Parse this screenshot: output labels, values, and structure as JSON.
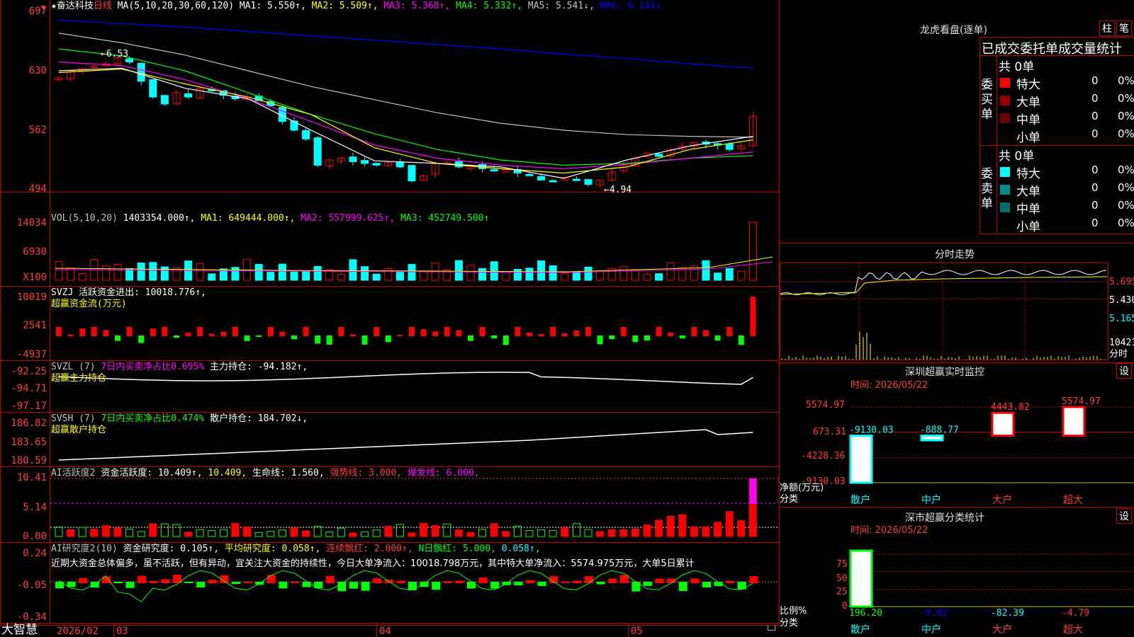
{
  "stock": {
    "star": "★",
    "name": "奋达科技",
    "period": "日线"
  },
  "main_legend": {
    "ma_label": "MA(5,10,20,30,60,120)",
    "ma1": "MA1: 5.550↑,",
    "ma2": "MA2: 5.509↑,",
    "ma3": "MA3: 5.368↑,",
    "ma4": "MA4: 5.332↑,",
    "ma5": "MA5: 5.541↓,",
    "ma6": "MA6: 6.141↓"
  },
  "price_axis": [
    "697",
    "630",
    "562",
    "494"
  ],
  "annotations": {
    "high": "←6.53",
    "low": "←4.94"
  },
  "vol_panel": {
    "label": "VOL(5,10,20)",
    "value": "1403354.000↑,",
    "ma1": "MA1: 649444.000↑,",
    "ma2": "MA2: 557999.625↑,",
    "ma3": "MA3: 452749.500↑",
    "axis": [
      "14034",
      "6930",
      "X100"
    ]
  },
  "svzj_panel": {
    "line1": "SVZJ  活跃资金进出: 10018.776↑,",
    "line2": "超赢资金流(万元)",
    "axis": [
      "10019",
      "2541",
      "-4937"
    ]
  },
  "svzl_panel": {
    "prefix": "SVZL (7)",
    "ratio": "7日内买卖净占比0.695%",
    "value": "主力持仓: -94.182↑,",
    "line2": "超赢主力持仓",
    "axis": [
      "-92.25",
      "-94.71",
      "-97.17"
    ]
  },
  "svsh_panel": {
    "prefix": "SVSH (7)",
    "ratio": "7日内买卖净占比0.474%",
    "value": "散户持仓: 184.702↓,",
    "line2": "超赢散户持仓",
    "axis": [
      "186.82",
      "183.65",
      "180.59"
    ]
  },
  "ai_active_panel": {
    "prefix": "AI活跃度2",
    "a": "资金活跃度: 10.409↑,",
    "b": "10.409,",
    "c": "生命线: 1.560,",
    "d": "强势线: 3.000,",
    "e": "爆发线: 6.000,",
    "axis": [
      "10.41",
      "5.14",
      "0.00"
    ]
  },
  "ai_research_panel": {
    "prefix": "AI研究度2(10)",
    "a": "资金研究度: 0.105↑,",
    "b": "平均研究度: 0.058↑,",
    "c": "连续飘红: 2.000↑,",
    "d": "N日飘红: 5.000,",
    "e": "0.058↑,",
    "comment": "近期大资金总体偏多，虽不活跃，但有异动，宜关注大资金的持续性，今日大单净流入：10018.798万元，其中特大单净流入：5574.975万元，大单5日累计",
    "axis": [
      "0.24",
      "-0.05",
      "-0.34"
    ]
  },
  "bottom_bar": {
    "brand": "大智慧",
    "date": "2026/02",
    "m3": "03",
    "m4": "04",
    "m5": "05"
  },
  "right_panel": {
    "title": "龙虎看盘(逐单)",
    "btn_zhu": "柱",
    "btn_bi": "笔",
    "header": "已成交委托单成交量统计",
    "buy_side": "委买单",
    "buy_count": "共 0单",
    "sell_side": "委卖单",
    "sell_count": "共 0单",
    "buy_rows": [
      {
        "label": "特大",
        "val": "0",
        "pct": "0%",
        "color": "#ff0000"
      },
      {
        "label": "大单",
        "val": "0",
        "pct": "0%",
        "color": "#9a0000"
      },
      {
        "label": "中单",
        "val": "0",
        "pct": "0%",
        "color": "#6b0000"
      },
      {
        "label": "小单",
        "val": "0",
        "pct": "0%",
        "color": ""
      }
    ],
    "sell_rows": [
      {
        "label": "特大",
        "val": "0",
        "pct": "0%",
        "color": "#00ffff"
      },
      {
        "label": "大单",
        "val": "0",
        "pct": "0%",
        "color": "#008b8b"
      },
      {
        "label": "中单",
        "val": "0",
        "pct": "0%",
        "color": "#006b6b"
      },
      {
        "label": "小单",
        "val": "0",
        "pct": "0%",
        "color": ""
      }
    ],
    "intraday": {
      "title": "分时走势",
      "axis": [
        "5.695",
        "5.430",
        "5.165",
        "10421",
        "分时"
      ]
    },
    "sz_monitor": {
      "title": "深圳超赢实时监控",
      "btn": "设",
      "date": "时间: 2026/05/22",
      "axis": [
        "5574.97",
        "673.31",
        "-4228.36",
        "-9130.03"
      ],
      "axis_note": "净额(万元)",
      "axis_note2": "分类"
    },
    "sz_stats": {
      "title": "深市超赢分类统计",
      "btn": "设",
      "date": "时间: 2026/05/22",
      "axis": [
        "75",
        "50",
        "25",
        "0"
      ],
      "axis_note": "比例%",
      "axis_note2": "分类"
    }
  },
  "chart_data": [
    {
      "type": "bar",
      "title": "深圳超赢实时监控",
      "ylabel": "净额(万元)",
      "categories": [
        "散户",
        "中户",
        "大户",
        "超大"
      ],
      "values": [
        -9130.03,
        -888.77,
        4443.82,
        5574.97
      ],
      "ylim": [
        -9130.03,
        5574.97
      ]
    },
    {
      "type": "bar",
      "title": "深市超赢分类统计",
      "ylabel": "比例%",
      "categories": [
        "散户",
        "中户",
        "大户",
        "超大"
      ],
      "values": [
        196.2,
        -9.02,
        -82.39,
        -4.79
      ],
      "ylim": [
        0,
        75
      ]
    }
  ],
  "colors": {
    "frame": "#c00000",
    "up": "#ff0000",
    "down": "#00ffff",
    "ma1": "#ffffff",
    "ma2": "#ffff00",
    "ma3": "#ff00ff",
    "ma4": "#00ff00",
    "ma5": "#c0c0c0",
    "ma6": "#0000ff"
  }
}
